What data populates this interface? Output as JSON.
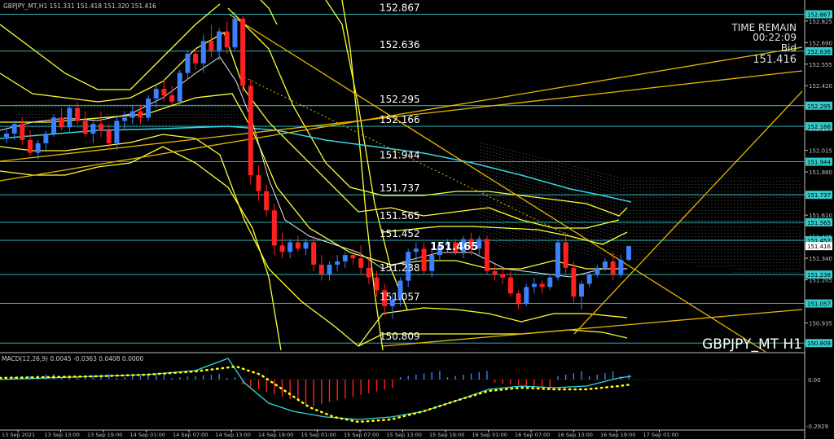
{
  "window": {
    "header": "GBPJPY_MT,H1  151.331 151.418 151.320 151.416",
    "symbol_watermark": "GBPJPY_MT H1"
  },
  "timer": {
    "label": "TIME REMAIN",
    "time": "00:22:09",
    "bid_label": "Bid",
    "bid_value": "151.416"
  },
  "current_price_label": "151.465",
  "macd": {
    "label": "MACD(12,26,9) 0.0045 -0.0363 0.0408 0.0000",
    "tick_labels": [
      "0.00",
      "-0.2929"
    ]
  },
  "colors": {
    "bull": "#3d7fff",
    "bear": "#ff2020",
    "level": "#33cccc",
    "band": "#ffff33",
    "trend": "#e6b800",
    "ma_cyan": "#33d6e6",
    "axis": "#c0c0c0"
  },
  "chart_data": {
    "type": "candlestick",
    "price_axis_ticks": [
      "152.825",
      "152.690",
      "152.555",
      "152.420",
      "152.285",
      "152.150",
      "152.015",
      "151.880",
      "151.745",
      "151.610",
      "151.475",
      "151.340",
      "151.205",
      "151.070",
      "150.935",
      "150.800"
    ],
    "ylim": [
      150.8,
      152.88
    ],
    "horizontal_levels": [
      {
        "label": "152.867",
        "value": 152.867
      },
      {
        "label": "152.636",
        "value": 152.636
      },
      {
        "label": "152.295",
        "value": 152.295
      },
      {
        "label": "152.166",
        "value": 152.166
      },
      {
        "label": "151.944",
        "value": 151.944
      },
      {
        "label": "151.737",
        "value": 151.737
      },
      {
        "label": "151.565",
        "value": 151.565
      },
      {
        "label": "151.452",
        "value": 151.452
      },
      {
        "label": "151.238",
        "value": 151.238
      },
      {
        "label": "151.057",
        "value": 151.057
      },
      {
        "label": "150.809",
        "value": 150.809
      }
    ],
    "axis_price_tags": [
      "152.867",
      "152.636",
      "152.295",
      "152.166",
      "151.944",
      "151.737",
      "151.565",
      "151.452",
      "151.416",
      "151.238",
      "151.057",
      "150.809"
    ],
    "time_labels": [
      "13 Sep 2021",
      "13 Sep 13:00",
      "13 Sep 19:00",
      "14 Sep 01:00",
      "14 Sep 07:00",
      "14 Sep 13:00",
      "14 Sep 19:00",
      "15 Sep 01:00",
      "15 Sep 07:00",
      "15 Sep 13:00",
      "15 Sep 19:00",
      "16 Sep 01:00",
      "16 Sep 07:00",
      "16 Sep 13:00",
      "16 Sep 19:00",
      "17 Sep 01:00"
    ],
    "candles": [
      [
        152.1,
        152.16,
        152.06,
        152.12
      ],
      [
        152.12,
        152.2,
        152.08,
        152.18
      ],
      [
        152.18,
        152.22,
        152.05,
        152.08
      ],
      [
        152.08,
        152.14,
        151.98,
        152.0
      ],
      [
        152.0,
        152.08,
        151.96,
        152.06
      ],
      [
        152.06,
        152.14,
        152.02,
        152.12
      ],
      [
        152.12,
        152.24,
        152.1,
        152.22
      ],
      [
        152.22,
        152.28,
        152.14,
        152.16
      ],
      [
        152.16,
        152.3,
        152.12,
        152.28
      ],
      [
        152.28,
        152.32,
        152.18,
        152.2
      ],
      [
        152.2,
        152.26,
        152.1,
        152.12
      ],
      [
        152.12,
        152.2,
        152.06,
        152.18
      ],
      [
        152.18,
        152.26,
        152.1,
        152.14
      ],
      [
        152.14,
        152.18,
        152.02,
        152.06
      ],
      [
        152.06,
        152.22,
        152.02,
        152.2
      ],
      [
        152.2,
        152.26,
        152.14,
        152.22
      ],
      [
        152.22,
        152.3,
        152.18,
        152.26
      ],
      [
        152.26,
        152.3,
        152.18,
        152.22
      ],
      [
        152.22,
        152.36,
        152.2,
        152.34
      ],
      [
        152.34,
        152.42,
        152.28,
        152.4
      ],
      [
        152.4,
        152.46,
        152.32,
        152.36
      ],
      [
        152.36,
        152.42,
        152.3,
        152.32
      ],
      [
        152.32,
        152.52,
        152.3,
        152.5
      ],
      [
        152.5,
        152.64,
        152.46,
        152.62
      ],
      [
        152.62,
        152.66,
        152.52,
        152.56
      ],
      [
        152.56,
        152.74,
        152.5,
        152.7
      ],
      [
        152.7,
        152.8,
        152.6,
        152.64
      ],
      [
        152.64,
        152.78,
        152.58,
        152.76
      ],
      [
        152.76,
        152.82,
        152.62,
        152.66
      ],
      [
        152.66,
        152.88,
        152.64,
        152.84
      ],
      [
        152.84,
        152.86,
        152.38,
        152.42
      ],
      [
        152.42,
        152.46,
        151.8,
        151.86
      ],
      [
        151.86,
        151.92,
        151.7,
        151.76
      ],
      [
        151.76,
        151.8,
        151.6,
        151.64
      ],
      [
        151.64,
        151.68,
        151.36,
        151.42
      ],
      [
        151.42,
        151.5,
        151.34,
        151.38
      ],
      [
        151.38,
        151.46,
        151.34,
        151.44
      ],
      [
        151.44,
        151.48,
        151.38,
        151.4
      ],
      [
        151.4,
        151.46,
        151.36,
        151.44
      ],
      [
        151.44,
        151.48,
        151.26,
        151.3
      ],
      [
        151.3,
        151.36,
        151.2,
        151.24
      ],
      [
        151.24,
        151.32,
        151.2,
        151.3
      ],
      [
        151.3,
        151.36,
        151.26,
        151.32
      ],
      [
        151.32,
        151.38,
        151.28,
        151.36
      ],
      [
        151.36,
        151.4,
        151.3,
        151.34
      ],
      [
        151.34,
        151.42,
        151.24,
        151.28
      ],
      [
        151.28,
        151.34,
        151.18,
        151.22
      ],
      [
        151.22,
        151.26,
        151.1,
        151.14
      ],
      [
        151.14,
        151.18,
        150.98,
        151.04
      ],
      [
        151.04,
        151.12,
        150.96,
        151.08
      ],
      [
        151.08,
        151.22,
        151.04,
        151.2
      ],
      [
        151.2,
        151.4,
        151.16,
        151.38
      ],
      [
        151.38,
        151.44,
        151.32,
        151.4
      ],
      [
        151.4,
        151.44,
        151.24,
        151.26
      ],
      [
        151.26,
        151.4,
        151.22,
        151.36
      ],
      [
        151.36,
        151.44,
        151.32,
        151.42
      ],
      [
        151.42,
        151.46,
        151.38,
        151.44
      ],
      [
        151.44,
        151.46,
        151.36,
        151.38
      ],
      [
        151.38,
        151.48,
        151.34,
        151.46
      ],
      [
        151.46,
        151.5,
        151.36,
        151.4
      ],
      [
        151.4,
        151.48,
        151.36,
        151.46
      ],
      [
        151.46,
        151.48,
        151.24,
        151.26
      ],
      [
        151.26,
        151.3,
        151.2,
        151.24
      ],
      [
        151.24,
        151.28,
        151.18,
        151.22
      ],
      [
        151.22,
        151.26,
        151.1,
        151.12
      ],
      [
        151.12,
        151.14,
        151.02,
        151.06
      ],
      [
        151.06,
        151.18,
        151.04,
        151.16
      ],
      [
        151.16,
        151.22,
        151.12,
        151.18
      ],
      [
        151.18,
        151.2,
        151.12,
        151.16
      ],
      [
        151.16,
        151.24,
        151.14,
        151.22
      ],
      [
        151.22,
        151.46,
        151.2,
        151.44
      ],
      [
        151.44,
        151.5,
        151.24,
        151.28
      ],
      [
        151.28,
        151.32,
        151.06,
        151.1
      ],
      [
        151.1,
        151.2,
        151.02,
        151.18
      ],
      [
        151.18,
        151.26,
        151.16,
        151.24
      ],
      [
        151.24,
        151.3,
        151.22,
        151.28
      ],
      [
        151.28,
        151.34,
        151.26,
        151.32
      ],
      [
        151.32,
        151.38,
        151.2,
        151.24
      ],
      [
        151.24,
        151.36,
        151.22,
        151.33
      ],
      [
        151.33,
        151.42,
        151.32,
        151.416
      ]
    ]
  }
}
